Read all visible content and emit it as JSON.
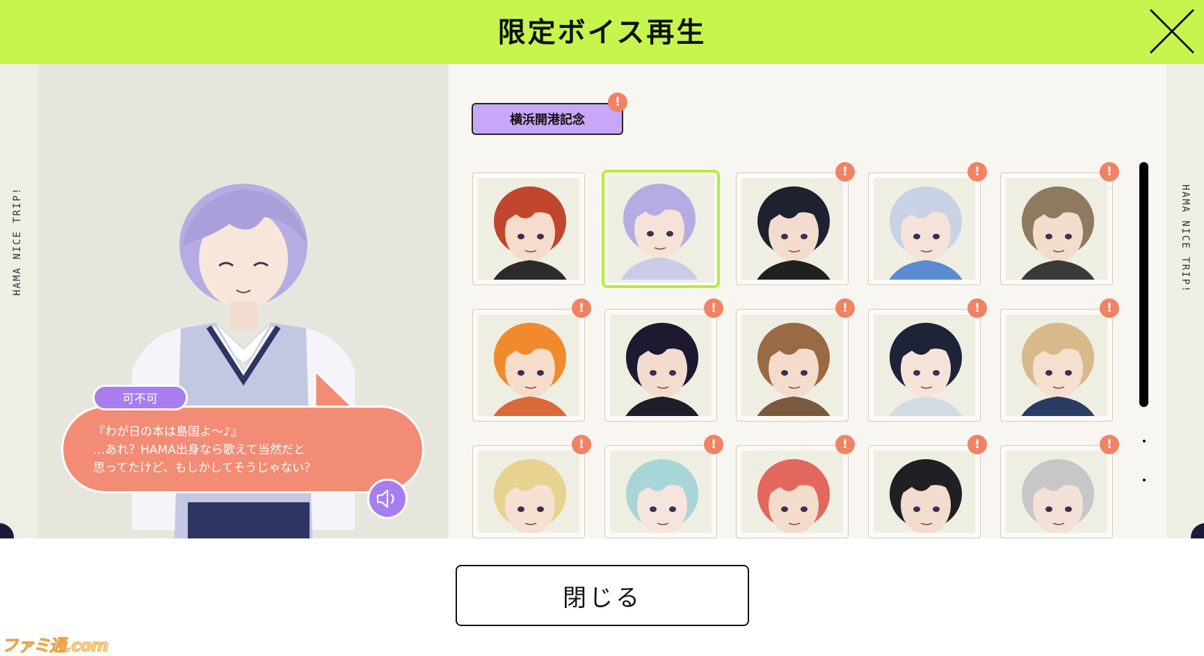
{
  "header": {
    "title": "限定ボイス再生"
  },
  "side_labels": {
    "left": "HAMA NICE TRIP!",
    "right": "HAMA NICE TRIP!"
  },
  "event_tab": {
    "label": "横浜開港記念",
    "has_new": true,
    "new_mark": "!"
  },
  "character_portraits": [
    {
      "hair": "#c2462d",
      "skin": "#f5dccb",
      "cloth": "#2b2b2b",
      "selected": false,
      "new": false
    },
    {
      "hair": "#b5ace4",
      "skin": "#f6e2d6",
      "cloth": "#c9cbe8",
      "selected": true,
      "new": false
    },
    {
      "hair": "#1e2230",
      "skin": "#f3dccd",
      "cloth": "#202020",
      "selected": false,
      "new": true
    },
    {
      "hair": "#c9d2e4",
      "skin": "#f5e2d8",
      "cloth": "#5a8ad0",
      "selected": false,
      "new": true
    },
    {
      "hair": "#8d7a5f",
      "skin": "#f2ddcd",
      "cloth": "#3a3a3a",
      "selected": false,
      "new": true
    },
    {
      "hair": "#f08a2c",
      "skin": "#f6dccb",
      "cloth": "#d9683a",
      "selected": false,
      "new": true
    },
    {
      "hair": "#1d1930",
      "skin": "#f3dccd",
      "cloth": "#1d1d2c",
      "selected": false,
      "new": true
    },
    {
      "hair": "#9a6a45",
      "skin": "#f3dccb",
      "cloth": "#7a5a3e",
      "selected": false,
      "new": true
    },
    {
      "hair": "#1e2438",
      "skin": "#f6e3da",
      "cloth": "#d2dbe4",
      "selected": false,
      "new": true
    },
    {
      "hair": "#d8b98a",
      "skin": "#f5dfcf",
      "cloth": "#2b3c64",
      "selected": false,
      "new": true
    },
    {
      "hair": "#e8d28f",
      "skin": "#f5e0d2",
      "cloth": "#56604a",
      "selected": false,
      "new": true
    },
    {
      "hair": "#a8d6d8",
      "skin": "#f6e5dc",
      "cloth": "#dde9ec",
      "selected": false,
      "new": true
    },
    {
      "hair": "#e2675d",
      "skin": "#f4dccd",
      "cloth": "#2b2b2b",
      "selected": false,
      "new": true
    },
    {
      "hair": "#1f1f24",
      "skin": "#f3dccd",
      "cloth": "#2a2a2a",
      "selected": false,
      "new": true
    },
    {
      "hair": "#c7c7c7",
      "skin": "#f3e0d6",
      "cloth": "#6e6e6e",
      "selected": false,
      "new": true
    }
  ],
  "dialogue": {
    "speaker": "可不可",
    "text": "『わが日の本は島国よ～♪』\n…あれ？HAMA出身なら歌えて当然だと\n思ってたけど、もしかしてそうじゃない？"
  },
  "footer": {
    "close_button": "閉じる"
  },
  "watermark": "ファミ通.com",
  "colors": {
    "header_bg": "#c6f64d",
    "accent_purple": "#a87df0",
    "tab_purple": "#c9a7f8",
    "bubble_salmon": "#f28c74",
    "badge_orange": "#f08364",
    "selected_green": "#b4ee3c"
  },
  "icons": {
    "close": "close-x-icon",
    "speaker": "speaker-icon",
    "new": "exclamation-badge-icon"
  }
}
